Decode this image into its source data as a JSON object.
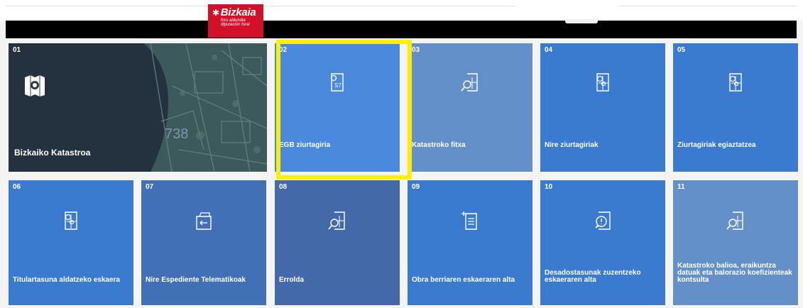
{
  "header": {
    "logo_text": "Bizkaia",
    "logo_sub1": "foru aldundia",
    "logo_sub2": "diputación foral",
    "brand_color": "#d3102a"
  },
  "map_label": "738",
  "tiles": [
    {
      "num": "01",
      "label": "Bizkaiko Katastroa",
      "icon": "cadastre-map-icon"
    },
    {
      "num": "02",
      "label": "EGB ziurtagiria",
      "icon": "certificate-document-icon",
      "icon_text": "S7"
    },
    {
      "num": "03",
      "label": "Katastroko fitxa",
      "icon": "search-document-icon"
    },
    {
      "num": "04",
      "label": "Nire ziurtagiriak",
      "icon": "map-pin-document-icon"
    },
    {
      "num": "05",
      "label": "Ziurtagiriak egiaztatzea",
      "icon": "map-pin-document-icon"
    },
    {
      "num": "06",
      "label": "Titulartasuna aldatzeko eskaera",
      "icon": "map-pin-document-icon"
    },
    {
      "num": "07",
      "label": "Nire Espediente Telematikoak",
      "icon": "folder-transfer-icon"
    },
    {
      "num": "08",
      "label": "Errolda",
      "icon": "search-document-icon"
    },
    {
      "num": "09",
      "label": "Obra berriaren eskaeraren alta",
      "icon": "add-list-document-icon"
    },
    {
      "num": "10",
      "label": "Desadostasunak zuzentzeko eskaeraren alta",
      "icon": "alert-message-document-icon"
    },
    {
      "num": "11",
      "label": "Katastroko balioa, eraikuntza datuak eta balorazio koefizienteak kontsulta",
      "icon": "search-document-icon"
    }
  ],
  "highlight_color": "#ffef00"
}
